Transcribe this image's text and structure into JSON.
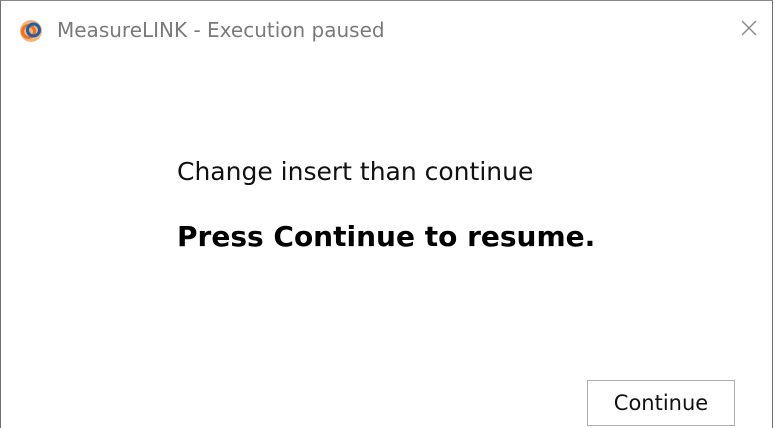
{
  "window": {
    "title": "MeasureLINK - Execution paused",
    "app_icon": "measurelink-logo-icon",
    "close_icon": "close-icon"
  },
  "content": {
    "message": "Change insert than continue",
    "instruction": "Press Continue to resume."
  },
  "buttons": {
    "continue_label": "Continue"
  },
  "colors": {
    "icon_orange": "#e8732a",
    "icon_blue": "#1f5fa8",
    "title_text": "#7a7a7a",
    "button_border": "#adadad"
  }
}
